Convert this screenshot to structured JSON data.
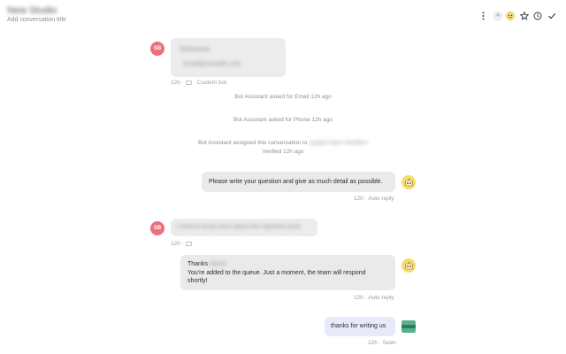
{
  "header": {
    "title": "New Studio",
    "subtitle": "Add conversation title"
  },
  "messages": [
    {
      "avatar": "SB",
      "blurred_line1": "Someone",
      "blurred_line2": "email@example.com",
      "meta": "12h · ",
      "meta2": "· Custom bot"
    },
    {
      "system": "Bot Assistant asked for Email 12h ago"
    },
    {
      "system": "Bot Assistant asked for Phone 12h ago"
    },
    {
      "system_prefix": "Bot Assistant assigned this conversation to",
      "system_blurred": "support team members",
      "system_line2": "Verified 12h ago"
    },
    {
      "text": "Please write your question and give as much detail as possible.",
      "meta": "12h · Auto reply"
    },
    {
      "avatar": "SB",
      "blurred": "I need to know more about the reported issue",
      "meta": "12h · "
    },
    {
      "line1_prefix": "Thanks ",
      "line1_blurred": "Name",
      "line2": "You're added to the queue. Just a moment, the team will respond",
      "line3": "shortly!",
      "meta": "12h · Auto reply"
    },
    {
      "text": "thanks for writing us",
      "meta": "12h · Seen"
    }
  ],
  "colors": {
    "avatar_red": "#ec6f7b",
    "bot_yellow": "#f7dc6b",
    "mine_bubble": "#e8eafb",
    "grey_bubble": "#ececec"
  }
}
